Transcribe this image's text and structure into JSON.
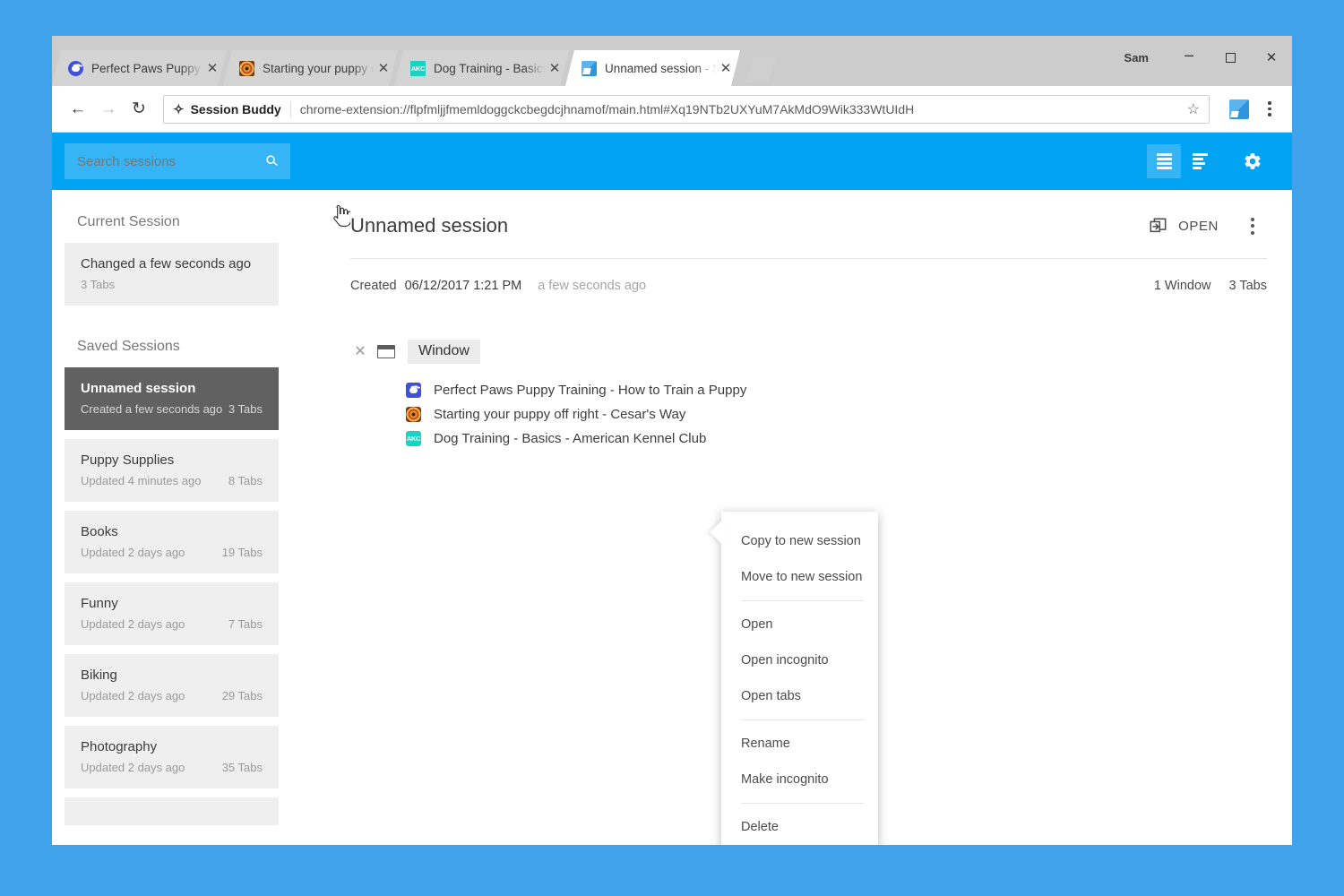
{
  "browser": {
    "user_name": "Sam",
    "window_controls": {
      "minimize": "–",
      "maximize": "",
      "close": "✕"
    },
    "tabs": [
      {
        "title": "Perfect Paws Puppy Train",
        "favicon": "paw-favicon",
        "active": false
      },
      {
        "title": "Starting your puppy off r",
        "favicon": "spiral-favicon",
        "active": false
      },
      {
        "title": "Dog Training - Basics - A",
        "favicon": "akc-favicon",
        "favicon_text": "AKC",
        "active": false
      },
      {
        "title": "Unnamed session - Sessi",
        "favicon": "session-buddy-favicon",
        "active": true
      }
    ],
    "nav": {
      "back": "←",
      "forward": "→",
      "reload": "↻"
    },
    "omnibox": {
      "extension_name": "Session Buddy",
      "url": "chrome-extension://flpfmljjfmemldoggckcbegdcjhnamof/main.html#Xq19NTb2UXYuM7AkMdO9Wik333WtUIdH",
      "star": "☆"
    }
  },
  "app_header": {
    "search": {
      "placeholder": "Search sessions",
      "icon": "search-icon"
    },
    "view_list_icon": "list-view-icon",
    "view_compact_icon": "compact-view-icon",
    "settings_icon": "gear-icon"
  },
  "sidebar": {
    "current_section_label": "Current Session",
    "current_session": {
      "title": "Changed a few seconds ago",
      "tabs": "3 Tabs"
    },
    "saved_section_label": "Saved Sessions",
    "saved_sessions": [
      {
        "title": "Unnamed session",
        "meta": "Created a few seconds ago",
        "tabs": "3 Tabs",
        "selected": true
      },
      {
        "title": "Puppy Supplies",
        "meta": "Updated 4 minutes ago",
        "tabs": "8 Tabs",
        "selected": false
      },
      {
        "title": "Books",
        "meta": "Updated 2 days ago",
        "tabs": "19 Tabs",
        "selected": false
      },
      {
        "title": "Funny",
        "meta": "Updated 2 days ago",
        "tabs": "7 Tabs",
        "selected": false
      },
      {
        "title": "Biking",
        "meta": "Updated 2 days ago",
        "tabs": "29 Tabs",
        "selected": false
      },
      {
        "title": "Photography",
        "meta": "Updated 2 days ago",
        "tabs": "35 Tabs",
        "selected": false
      }
    ]
  },
  "detail": {
    "session_name": "Unnamed session",
    "open_label": "OPEN",
    "open_icon": "open-in-window-icon",
    "kebab_icon": "more-vertical-icon",
    "created_label": "Created",
    "created_date": "06/12/2017 1:21 PM",
    "created_relative": "a few seconds ago",
    "window_count": "1 Window",
    "tab_count": "3 Tabs",
    "window": {
      "close_icon": "✕",
      "label": "Window",
      "tabs": [
        {
          "title": "Perfect Paws Puppy Training - How to Train a Puppy",
          "favicon": "paw-favicon"
        },
        {
          "title": "Starting your puppy off right - Cesar's Way",
          "favicon": "spiral-favicon"
        },
        {
          "title": "Dog Training - Basics - American Kennel Club",
          "favicon": "akc-favicon",
          "favicon_text": "AKC"
        }
      ]
    }
  },
  "context_menu": {
    "groups": [
      [
        "Copy to new session",
        "Move to new session"
      ],
      [
        "Open",
        "Open incognito",
        "Open tabs"
      ],
      [
        "Rename",
        "Make incognito"
      ],
      [
        "Delete"
      ]
    ]
  },
  "colors": {
    "accent_blue": "#03a3f4",
    "desktop_blue": "#41a2ec",
    "selected_gray": "#616161",
    "card_gray": "#efefef"
  }
}
